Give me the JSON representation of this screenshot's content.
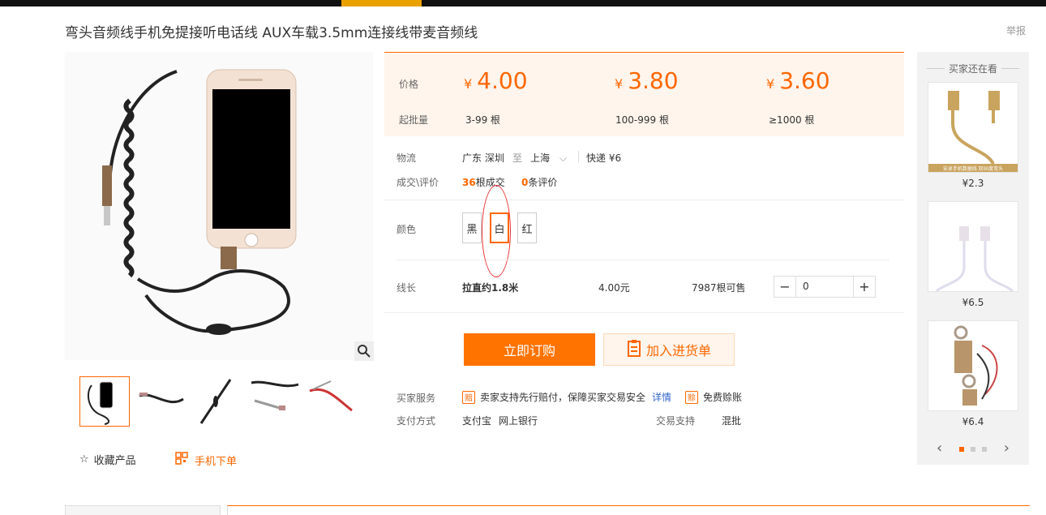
{
  "product": {
    "title": "弯头音频线手机免提接听电话线 AUX车载3.5mm连接线带麦音频线",
    "report": "举报"
  },
  "price_panel": {
    "price_label": "价格",
    "min_label": "起批量",
    "currency": "¥",
    "tiers": [
      {
        "price": "4.00",
        "qty": "3-99 根"
      },
      {
        "price": "3.80",
        "qty": "100-999 根"
      },
      {
        "price": "3.60",
        "qty": "≥1000 根"
      }
    ]
  },
  "logistics": {
    "label": "物流",
    "from": "广东 深圳",
    "to_word": "至",
    "to": "上海",
    "express": "快递 ¥6"
  },
  "deals": {
    "label": "成交\\评价",
    "sold_count": "36",
    "sold_text": "根成交",
    "review_count": "0",
    "review_text": "条评价"
  },
  "color": {
    "label": "颜色",
    "options": [
      "黑",
      "白",
      "红"
    ],
    "selected": "白"
  },
  "spec": {
    "label": "线长",
    "name": "拉直约1.8米",
    "price": "4.00元",
    "stock": "7987根可售",
    "qty": "0",
    "minus": "−",
    "plus": "+"
  },
  "actions": {
    "order": "立即订购",
    "cart": "加入进货单"
  },
  "service": {
    "buyer_label": "买家服务",
    "guarantee_icon": "赔",
    "guarantee": "卖家支持先行赔付，保障买家交易安全",
    "details": "详情",
    "free_icon": "赊",
    "free": "免费赊账",
    "pay_label": "支付方式",
    "pay_methods": [
      "支付宝",
      "网上银行"
    ],
    "trade_label": "交易支持",
    "trade_value": "混批"
  },
  "gallery": {
    "fav": "收藏产品",
    "mobile": "手机下单"
  },
  "side": {
    "title": "买家还在看",
    "items": [
      {
        "price": "¥2.3",
        "caption": "安卓手机数据线 双90度弯头"
      },
      {
        "price": "¥6.5"
      },
      {
        "price": "¥6.4"
      }
    ]
  },
  "colors": {
    "accent": "#ff6600",
    "panel": "#fff5ec"
  }
}
